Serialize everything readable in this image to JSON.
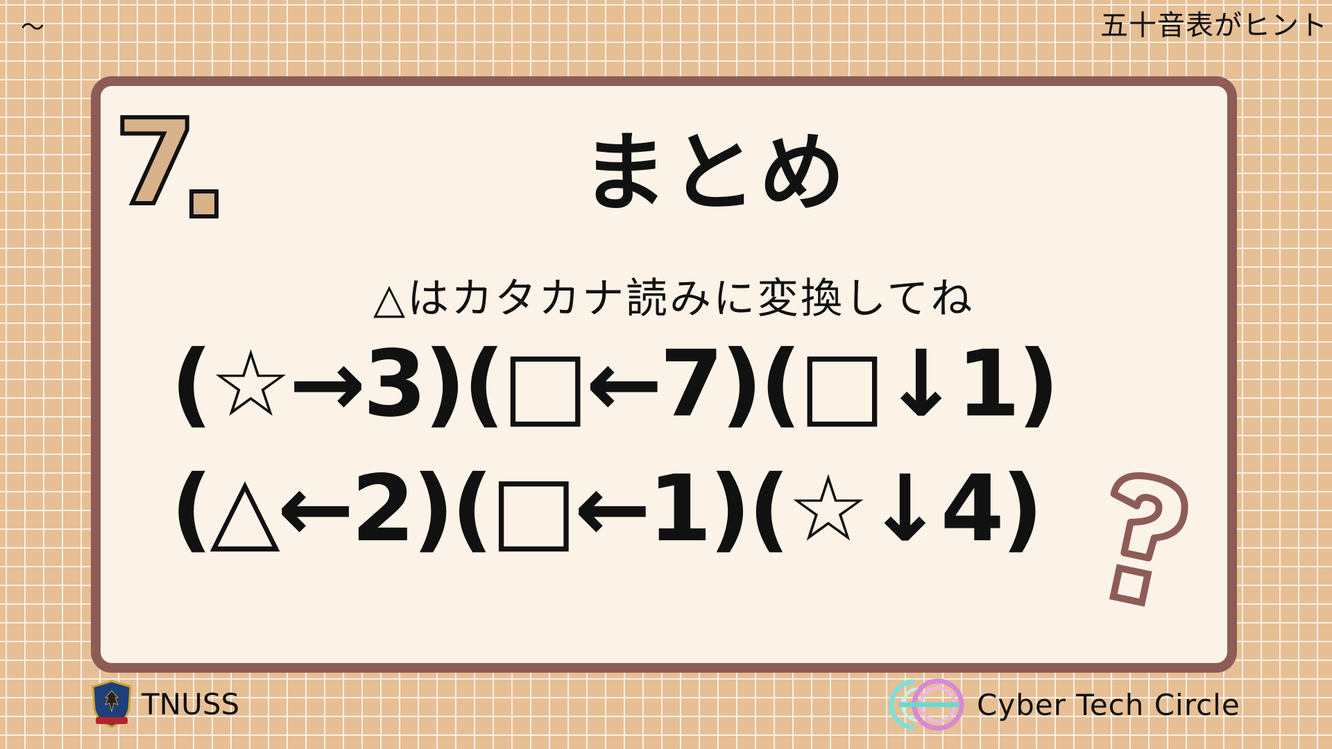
{
  "header": {
    "tilde": "〜",
    "hint": "五十音表がヒント"
  },
  "card": {
    "number": "7",
    "title": "まとめ",
    "instruction": "△はカタカナ読みに変換してね",
    "rows": [
      "(☆→3)(□←7)(□↓1)",
      "(△←2)(□←1)(☆↓4)"
    ]
  },
  "footer": {
    "left_label": "TNUSS",
    "right_label": "Cyber Tech Circle"
  },
  "colors": {
    "background": "#e7bf94",
    "card": "#fcf3e8",
    "card_border": "#8e5c57",
    "number_fill": "#d8b28b"
  },
  "icons": [
    "crest-icon",
    "cyber-tech-logo-icon",
    "question-mark-icon"
  ]
}
